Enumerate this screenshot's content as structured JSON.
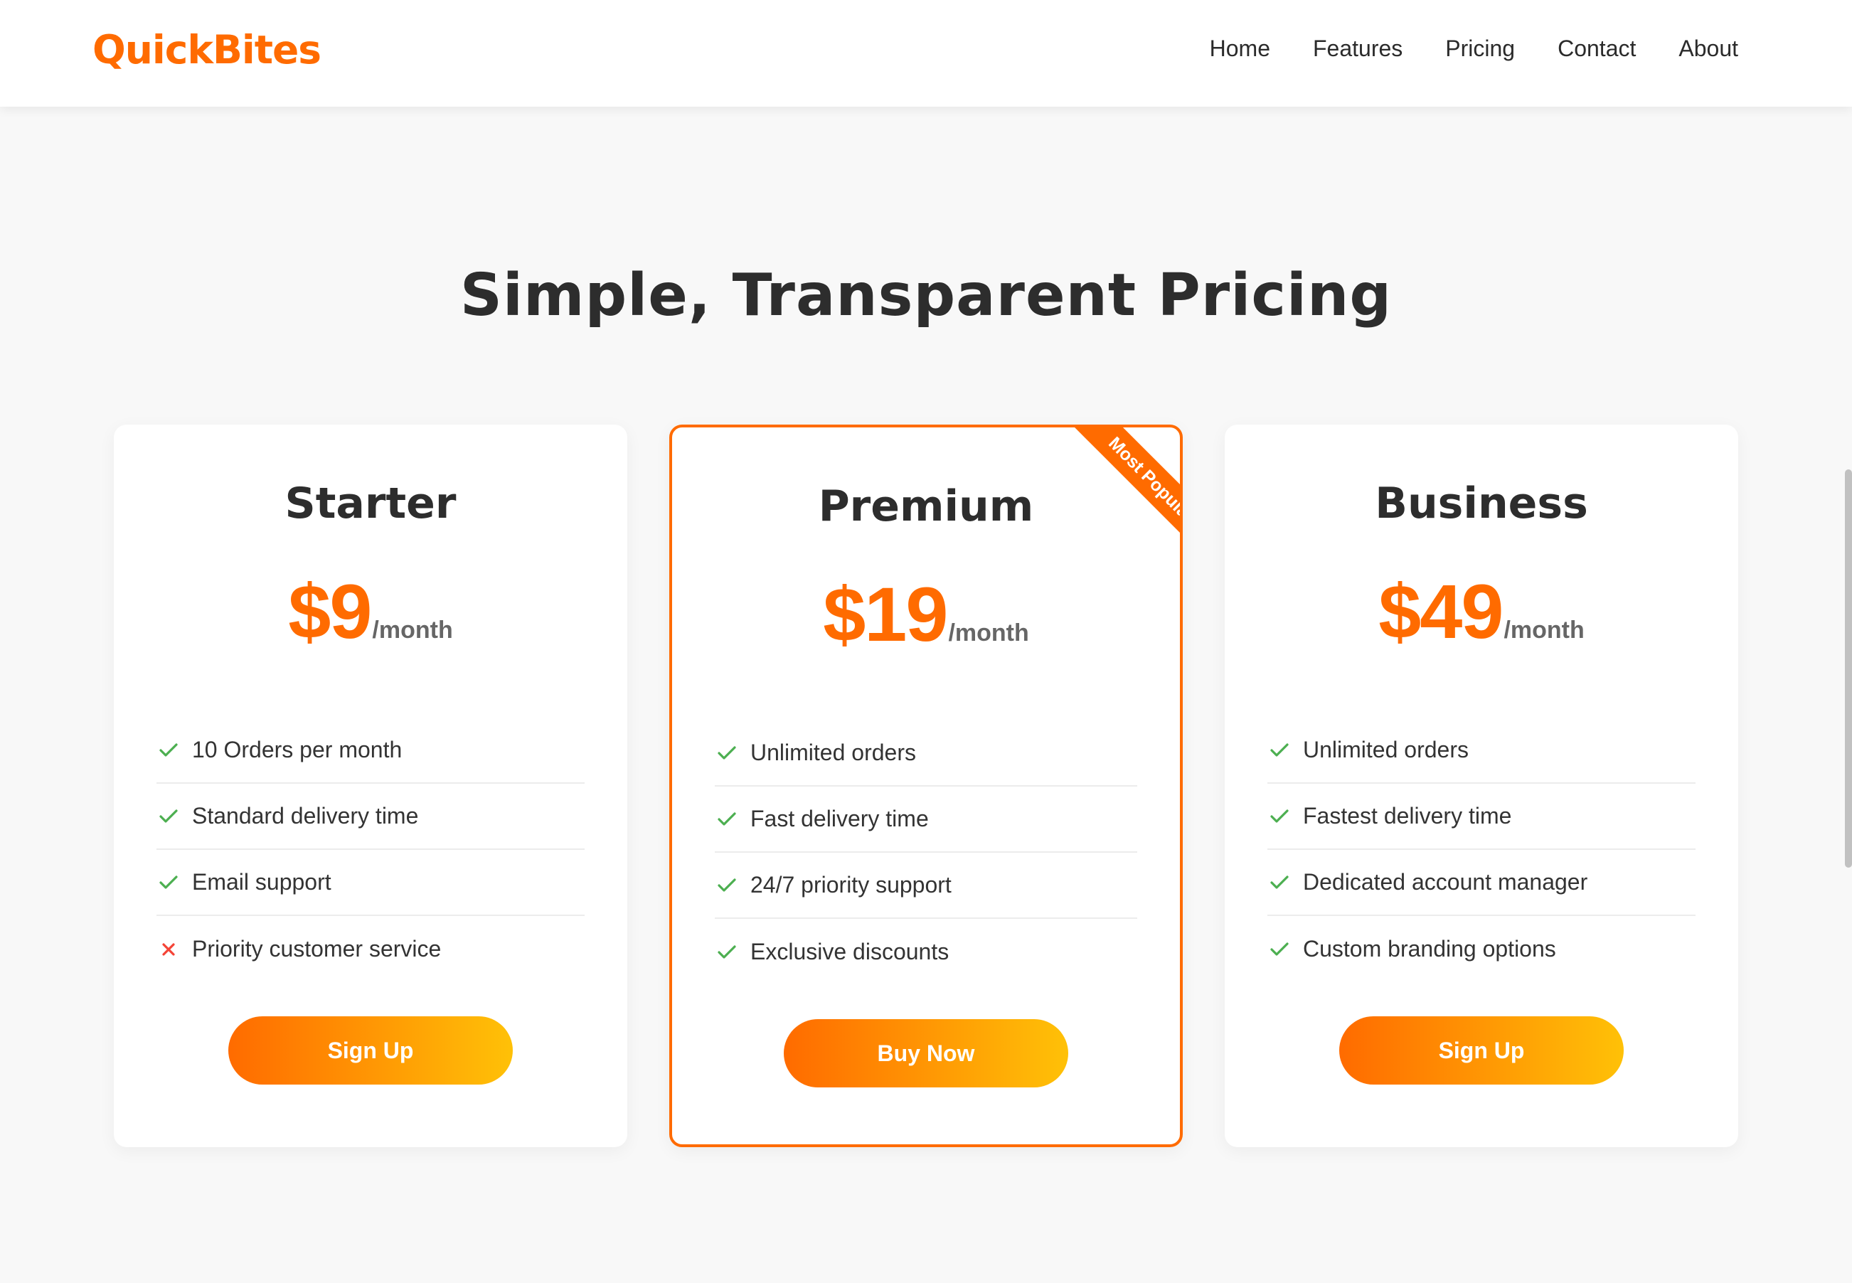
{
  "header": {
    "logo": "QuickBites",
    "nav": [
      "Home",
      "Features",
      "Pricing",
      "Contact",
      "About"
    ]
  },
  "section": {
    "title": "Simple, Transparent Pricing"
  },
  "plans": [
    {
      "name": "Starter",
      "price": "$9",
      "period": "/month",
      "featured": false,
      "features": [
        {
          "text": "10 Orders per month",
          "included": true
        },
        {
          "text": "Standard delivery time",
          "included": true
        },
        {
          "text": "Email support",
          "included": true
        },
        {
          "text": "Priority customer service",
          "included": false
        }
      ],
      "button": "Sign Up"
    },
    {
      "name": "Premium",
      "price": "$19",
      "period": "/month",
      "featured": true,
      "badge": "Most Popular",
      "features": [
        {
          "text": "Unlimited orders",
          "included": true
        },
        {
          "text": "Fast delivery time",
          "included": true
        },
        {
          "text": "24/7 priority support",
          "included": true
        },
        {
          "text": "Exclusive discounts",
          "included": true
        }
      ],
      "button": "Buy Now"
    },
    {
      "name": "Business",
      "price": "$49",
      "period": "/month",
      "featured": false,
      "features": [
        {
          "text": "Unlimited orders",
          "included": true
        },
        {
          "text": "Fastest delivery time",
          "included": true
        },
        {
          "text": "Dedicated account manager",
          "included": true
        },
        {
          "text": "Custom branding options",
          "included": true
        }
      ],
      "button": "Sign Up"
    }
  ],
  "icons": {
    "included": "check-icon",
    "excluded": "cross-icon"
  },
  "colors": {
    "accent": "#ff6b00",
    "gradient_end": "#ffc107",
    "check": "#4caf50",
    "cross": "#f44336"
  }
}
